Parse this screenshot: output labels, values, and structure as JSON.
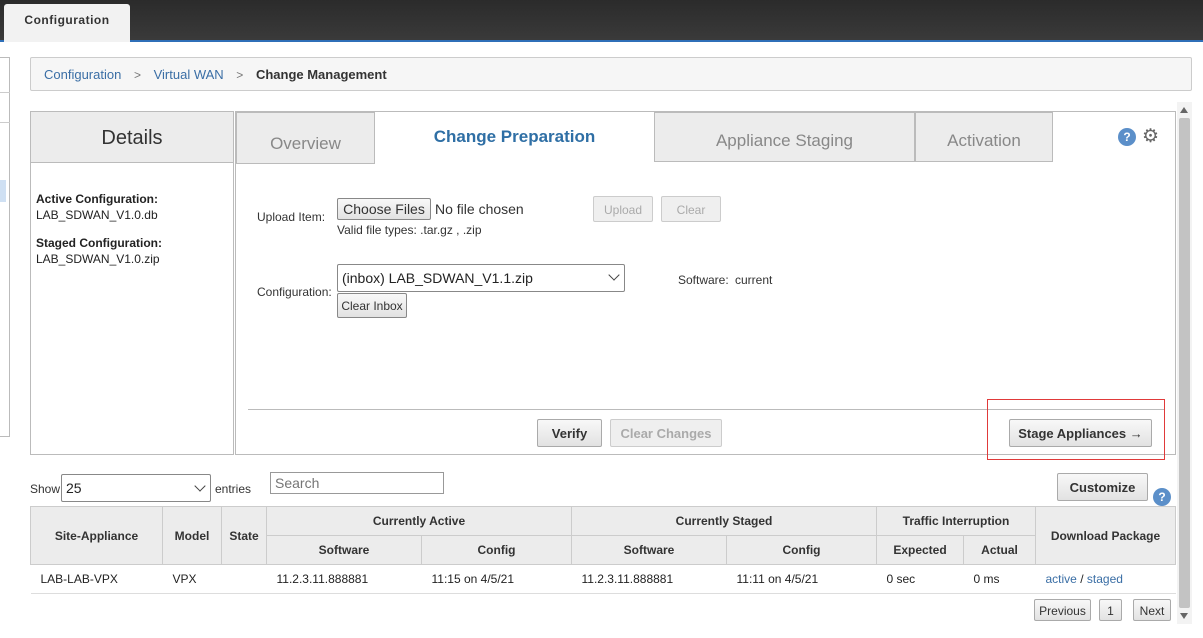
{
  "app": {
    "top_tab": "Configuration"
  },
  "breadcrumb": {
    "items": [
      "Configuration",
      "Virtual WAN"
    ],
    "current": "Change Management"
  },
  "details": {
    "title": "Details",
    "active_label": "Active Configuration:",
    "active_value": "LAB_SDWAN_V1.0.db",
    "staged_label": "Staged Configuration:",
    "staged_value": "LAB_SDWAN_V1.0.zip"
  },
  "tabs": [
    "Overview",
    "Change Preparation",
    "Appliance Staging",
    "Activation"
  ],
  "help_glyph": "?",
  "upload": {
    "label": "Upload Item:",
    "choose_files": "Choose Files",
    "no_file": "No file chosen",
    "valid_types": "Valid file types: .tar.gz , .zip",
    "upload_button": "Upload",
    "clear_button": "Clear"
  },
  "configuration": {
    "label": "Configuration:",
    "selected": "(inbox) LAB_SDWAN_V1.1.zip",
    "clear_inbox": "Clear Inbox",
    "software_label": "Software:",
    "software_value": "current"
  },
  "actions": {
    "verify": "Verify",
    "clear_changes": "Clear Changes",
    "stage_appliances": "Stage Appliances →"
  },
  "table_controls": {
    "show": "Show",
    "page_size": "25",
    "entries": "entries",
    "search_placeholder": "Search",
    "customize": "Customize"
  },
  "table": {
    "headers": {
      "site_appliance": "Site-Appliance",
      "model": "Model",
      "state": "State",
      "currently_active": "Currently Active",
      "currently_staged": "Currently Staged",
      "traffic_interruption": "Traffic Interruption",
      "download_package": "Download Package",
      "software": "Software",
      "config": "Config",
      "expected": "Expected",
      "actual": "Actual"
    },
    "rows": [
      {
        "site_appliance": "LAB-LAB-VPX",
        "model": "VPX",
        "state": "",
        "active_software": "11.2.3.11.888881",
        "active_config": "11:15 on 4/5/21",
        "staged_software": "11.2.3.11.888881",
        "staged_config": "11:11 on 4/5/21",
        "expected": "0 sec",
        "actual": "0 ms",
        "download_active": "active",
        "download_sep": "/",
        "download_staged": "staged"
      }
    ]
  },
  "pagination": {
    "previous": "Previous",
    "page": "1",
    "next": "Next"
  },
  "colors": {
    "accent": "#2f6fa5",
    "highlight": "#e03a3a",
    "link": "#3a6ea5"
  }
}
